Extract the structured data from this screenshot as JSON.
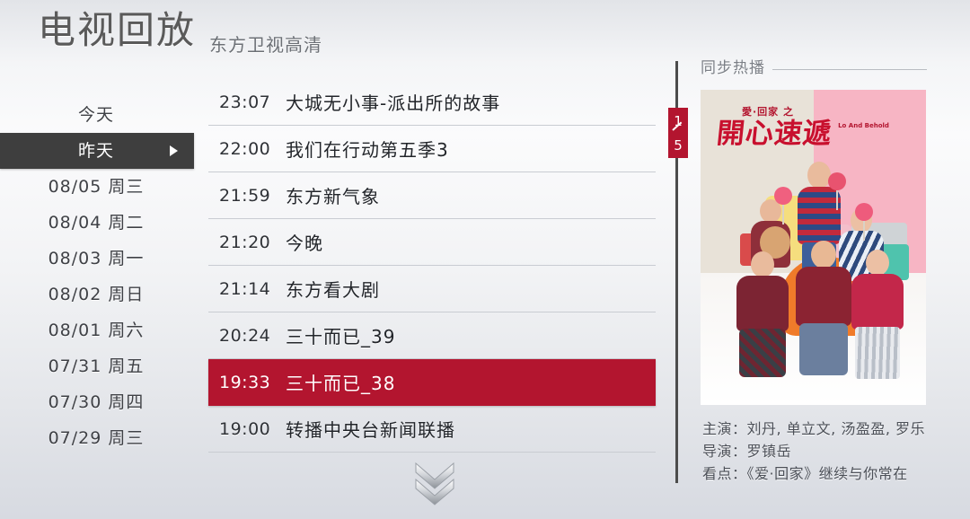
{
  "page": {
    "title": "电视回放",
    "channel_name": "东方卫视高清"
  },
  "date_sidebar": {
    "items": [
      {
        "label": "今天",
        "selected": false
      },
      {
        "label": "昨天",
        "selected": true
      },
      {
        "label": "08/05  周三",
        "selected": false
      },
      {
        "label": "08/04  周二",
        "selected": false
      },
      {
        "label": "08/03  周一",
        "selected": false
      },
      {
        "label": "08/02  周日",
        "selected": false
      },
      {
        "label": "08/01  周六",
        "selected": false
      },
      {
        "label": "07/31  周五",
        "selected": false
      },
      {
        "label": "07/30  周四",
        "selected": false
      },
      {
        "label": "07/29  周三",
        "selected": false
      }
    ]
  },
  "program_list": {
    "rows": [
      {
        "time": "23:07",
        "title": "大城无小事-派出所的故事",
        "active": false
      },
      {
        "time": "22:00",
        "title": "我们在行动第五季3",
        "active": false
      },
      {
        "time": "21:59",
        "title": "东方新气象",
        "active": false
      },
      {
        "time": "21:20",
        "title": "今晚",
        "active": false
      },
      {
        "time": "21:14",
        "title": "东方看大剧",
        "active": false
      },
      {
        "time": "20:24",
        "title": "三十而已_39",
        "active": false
      },
      {
        "time": "19:33",
        "title": "三十而已_38",
        "active": true
      },
      {
        "time": "19:00",
        "title": "转播中央台新闻联播",
        "active": false
      }
    ],
    "scroll_down_icon": "double-chevron-down-icon"
  },
  "page_badge": {
    "current": "1",
    "total": "5"
  },
  "promo": {
    "header_label": "同步热播",
    "poster": {
      "logo_small": "愛·回家 之",
      "logo_main": "開心速遞",
      "logo_en": "Lo And Behold"
    },
    "credits": [
      "主演：刘丹, 单立文, 汤盈盈, 罗乐",
      "导演：罗镇岳",
      "看点：《爱·回家》继续与你常在"
    ]
  },
  "colors": {
    "accent_red": "#b3152f",
    "selected_dark": "#3e3e3e",
    "divider": "#4c4c4c",
    "title_text": "#5a5a5a"
  }
}
